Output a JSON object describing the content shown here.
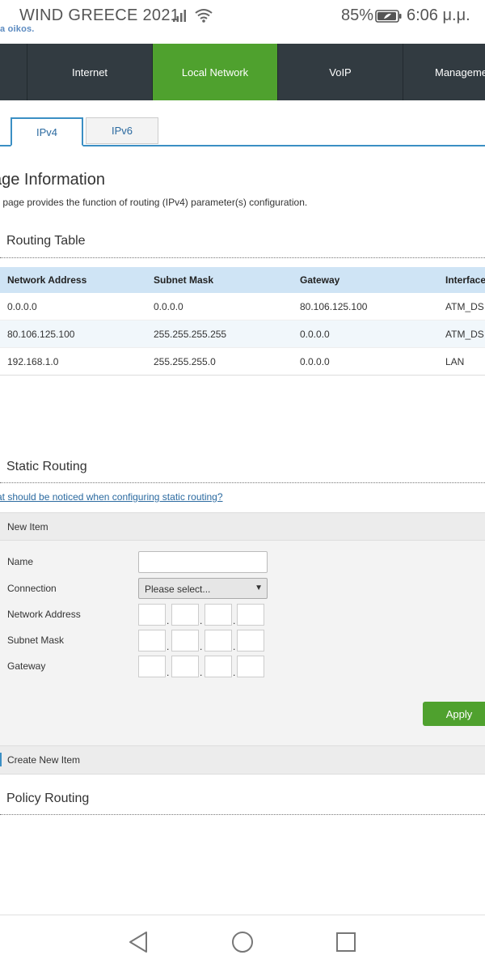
{
  "status_bar": {
    "carrier": "WIND GREECE 2021",
    "battery": "85%",
    "time": "6:06 μ.μ."
  },
  "header": {
    "logo_fragment": "a oikos."
  },
  "nav": {
    "items": [
      {
        "label": "Internet"
      },
      {
        "label": "Local Network"
      },
      {
        "label": "VoIP"
      },
      {
        "label": "Manageme"
      }
    ]
  },
  "tabs": [
    {
      "label": "IPv4"
    },
    {
      "label": "IPv6"
    }
  ],
  "page_info": {
    "title": "age Information",
    "description": "s page provides the function of routing (IPv4) parameter(s) configuration."
  },
  "routing_table": {
    "title": "Routing Table",
    "columns": [
      "Network Address",
      "Subnet Mask",
      "Gateway",
      "Interface"
    ],
    "rows": [
      [
        "0.0.0.0",
        "0.0.0.0",
        "80.106.125.100",
        "ATM_DS"
      ],
      [
        "80.106.125.100",
        "255.255.255.255",
        "0.0.0.0",
        "ATM_DS"
      ],
      [
        "192.168.1.0",
        "255.255.255.0",
        "0.0.0.0",
        "LAN"
      ]
    ]
  },
  "static_routing": {
    "title": "Static Routing",
    "help_link": "at should be noticed when configuring static routing?",
    "new_item": "New Item",
    "labels": {
      "name": "Name",
      "connection": "Connection",
      "network_address": "Network Address",
      "subnet_mask": "Subnet Mask",
      "gateway": "Gateway"
    },
    "connection_value": "Please select...",
    "apply": "Apply",
    "create_new": "Create New Item"
  },
  "policy_routing": {
    "title": "Policy Routing"
  }
}
